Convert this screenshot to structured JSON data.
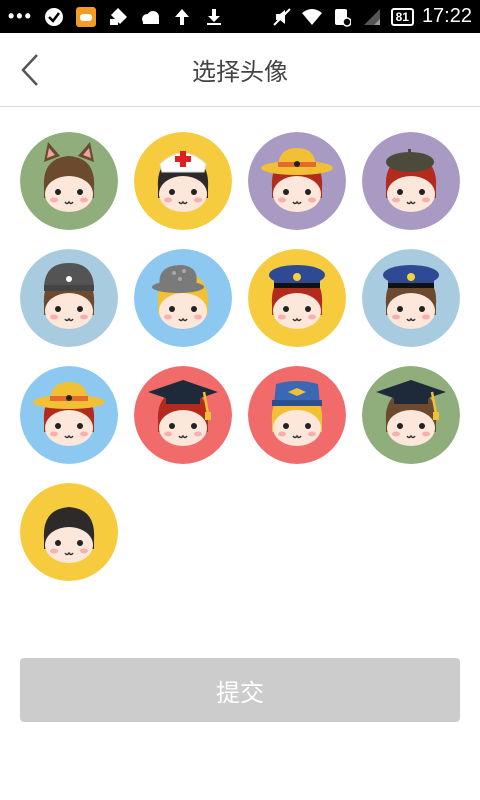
{
  "status_bar": {
    "dots": "•••",
    "battery": "81",
    "time": "17:22",
    "icons": [
      "check-circle-icon",
      "game-icon",
      "tag-icon",
      "weather-icon",
      "upload-icon",
      "download-icon",
      "mute-icon",
      "wifi-icon",
      "sim-icon",
      "signal-icon",
      "battery-icon"
    ]
  },
  "header": {
    "title": "选择头像",
    "back_icon": "chevron-left-icon"
  },
  "avatars": [
    {
      "bg": "#8fae7c",
      "hair": "#6b4a2e",
      "hat": "cat-ears",
      "hat_color": "#6b4a2e",
      "accent": "#e8a5a5"
    },
    {
      "bg": "#f6cc3e",
      "hair": "#2f2a2a",
      "hat": "nurse",
      "hat_color": "#ffffff",
      "accent": "#e02020"
    },
    {
      "bg": "#a99ac4",
      "hair": "#b32b1d",
      "hat": "straw",
      "hat_color": "#f2c035",
      "accent": "#e46a2e"
    },
    {
      "bg": "#a99ac4",
      "hair": "#b32b1d",
      "hat": "beret",
      "hat_color": "#4b4a3b",
      "accent": "#4b4a3b"
    },
    {
      "bg": "#a9cbe0",
      "hair": "#6b4a2e",
      "hat": "beanie",
      "hat_color": "#545454",
      "accent": "#ffffff"
    },
    {
      "bg": "#8cc8ef",
      "hair": "#f2c035",
      "hat": "fedora",
      "hat_color": "#7a7a7a",
      "accent": "#a7a7a7"
    },
    {
      "bg": "#f6cc3e",
      "hair": "#b32b1d",
      "hat": "police",
      "hat_color": "#2e4a95",
      "accent": "#f5d23b"
    },
    {
      "bg": "#a9cbe0",
      "hair": "#6b4a2e",
      "hat": "police",
      "hat_color": "#2e4a95",
      "accent": "#f5d23b"
    },
    {
      "bg": "#8cc8ef",
      "hair": "#b32b1d",
      "hat": "straw",
      "hat_color": "#f2c035",
      "accent": "#e46a2e"
    },
    {
      "bg": "#f26b6b",
      "hair": "#b32b1d",
      "hat": "grad",
      "hat_color": "#1e2a3a",
      "accent": "#f2c035"
    },
    {
      "bg": "#f26b6b",
      "hair": "#f2c035",
      "hat": "pilot",
      "hat_color": "#3a68b5",
      "accent": "#f2c035"
    },
    {
      "bg": "#8fae7c",
      "hair": "#6b4a2e",
      "hat": "grad",
      "hat_color": "#1e2a3a",
      "accent": "#f2c035"
    },
    {
      "bg": "#f6cc3e",
      "hair": "#2f2a2a",
      "hat": "none",
      "hat_color": "#2f2a2a",
      "accent": "#2f2a2a"
    }
  ],
  "submit": {
    "label": "提交"
  }
}
